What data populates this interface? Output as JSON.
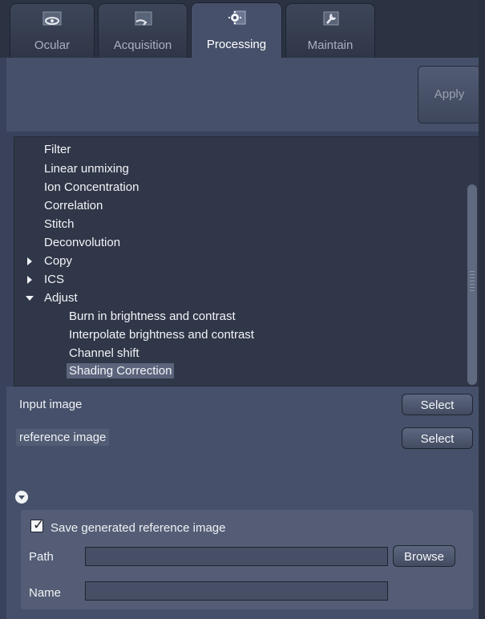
{
  "tabs": [
    {
      "label": "Ocular",
      "icon": "eye-icon"
    },
    {
      "label": "Acquisition",
      "icon": "acquisition-icon"
    },
    {
      "label": "Processing",
      "icon": "gear-icon"
    },
    {
      "label": "Maintain",
      "icon": "wrench-icon"
    }
  ],
  "active_tab": "Processing",
  "apply_label": "Apply",
  "tree": {
    "items": [
      {
        "label": "Filter"
      },
      {
        "label": "Linear unmixing"
      },
      {
        "label": "Ion Concentration"
      },
      {
        "label": "Correlation"
      },
      {
        "label": "Stitch"
      },
      {
        "label": "Deconvolution"
      },
      {
        "label": "Copy",
        "expanded": false
      },
      {
        "label": "ICS",
        "expanded": false
      },
      {
        "label": "Adjust",
        "expanded": true
      },
      {
        "label": "Burn in brightness and contrast"
      },
      {
        "label": "Interpolate brightness and contrast"
      },
      {
        "label": "Channel shift"
      },
      {
        "label": "Shading Correction",
        "selected": true
      }
    ]
  },
  "params": {
    "input_image_label": "Input image",
    "input_select_label": "Select",
    "reference_image_label": "reference image",
    "reference_select_label": "Select",
    "save_reference_label": "Save generated reference image",
    "save_reference_checked": true,
    "path_label": "Path",
    "path_value": "",
    "browse_label": "Browse",
    "name_label": "Name",
    "name_value": ""
  },
  "colors": {
    "panel": "#46506a",
    "tree_bg": "#303748",
    "selection": "#5b647b"
  }
}
